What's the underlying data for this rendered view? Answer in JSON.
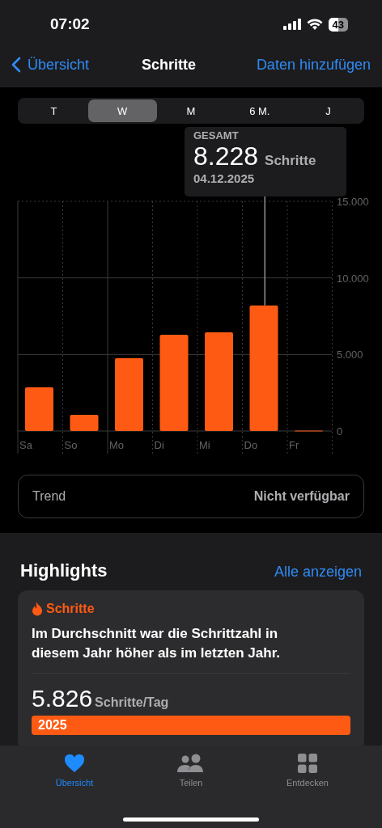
{
  "status_bar": {
    "time": "07:02",
    "battery": "43"
  },
  "nav": {
    "back": "Übersicht",
    "title": "Schritte",
    "action": "Daten hinzufügen"
  },
  "segments": [
    {
      "label": "T",
      "selected": false
    },
    {
      "label": "W",
      "selected": true
    },
    {
      "label": "M",
      "selected": false
    },
    {
      "label": "6 M.",
      "selected": false
    },
    {
      "label": "J",
      "selected": false
    }
  ],
  "tooltip": {
    "label": "GESAMT",
    "value": "8.228",
    "unit": "Schritte",
    "date": "04.12.2025"
  },
  "chart_data": {
    "type": "bar",
    "categories": [
      "Sa",
      "So",
      "Mo",
      "Di",
      "Mi",
      "Do",
      "Fr"
    ],
    "values": [
      2850,
      1060,
      4750,
      6290,
      6440,
      8200,
      30
    ],
    "ylim": [
      0,
      15000
    ],
    "yticks": [
      {
        "value": 0,
        "label": "0"
      },
      {
        "value": 5000,
        "label": "5.000"
      },
      {
        "value": 10000,
        "label": "10.000"
      },
      {
        "value": 15000,
        "label": "15.000"
      }
    ]
  },
  "trend": {
    "label": "Trend",
    "value": "Nicht verfügbar"
  },
  "highlights": {
    "title": "Highlights",
    "link": "Alle anzeigen",
    "card": {
      "category": "Schritte",
      "text": "Im Durchschnitt war die Schrittzahl in diesem Jahr höher als im letzten Jahr.",
      "value": "5.826",
      "unit": "Schritte/Tag",
      "bar_label": "2025"
    }
  },
  "tab_bar": [
    {
      "label": "Übersicht",
      "kind": "heart",
      "selected": true
    },
    {
      "label": "Teilen",
      "kind": "people",
      "selected": false
    },
    {
      "label": "Entdecken",
      "kind": "grid",
      "selected": false
    }
  ]
}
